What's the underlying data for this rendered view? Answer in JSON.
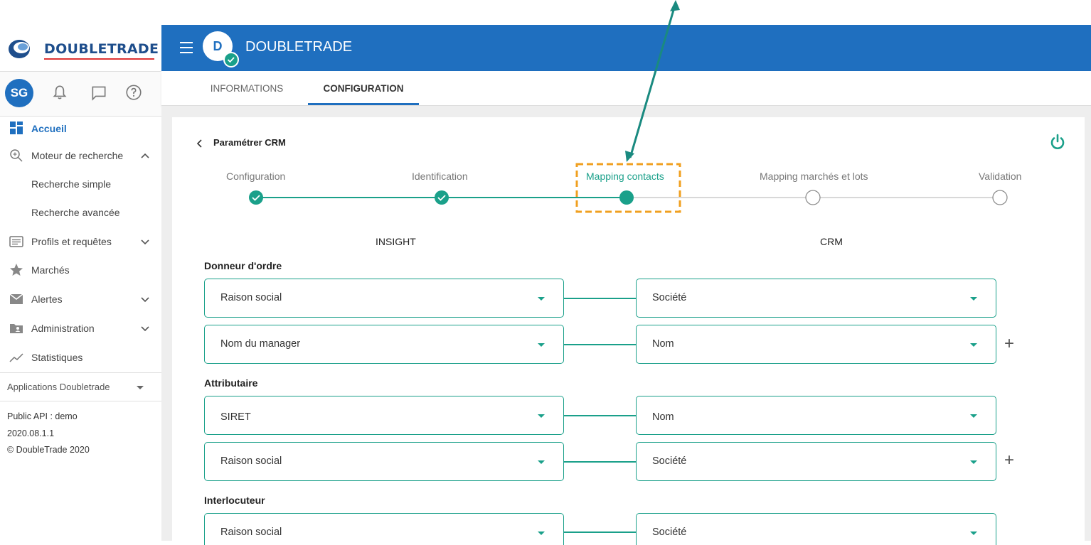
{
  "brand": {
    "logo_text": "DOUBLETRADE",
    "header_title": "DOUBLETRADE",
    "header_avatar": "D",
    "accent": "#1f6fbf",
    "teal": "#1aa08a"
  },
  "user": {
    "initials": "SG"
  },
  "sidebar": {
    "items": [
      {
        "label": "Accueil",
        "icon": "dashboard-icon"
      },
      {
        "label": "Moteur de recherche",
        "icon": "search-icon"
      },
      {
        "label": "Recherche simple"
      },
      {
        "label": "Recherche avancée"
      },
      {
        "label": "Profils et requêtes",
        "icon": "list-icon"
      },
      {
        "label": "Marchés",
        "icon": "star-icon"
      },
      {
        "label": "Alertes",
        "icon": "mail-icon"
      },
      {
        "label": "Administration",
        "icon": "admin-icon"
      },
      {
        "label": "Statistiques",
        "icon": "chart-icon"
      }
    ],
    "apps_label": "Applications Doubletrade",
    "footer": [
      "Public API : demo",
      "2020.08.1.1",
      "© DoubleTrade 2020"
    ]
  },
  "tabs": [
    {
      "label": "INFORMATIONS"
    },
    {
      "label": "CONFIGURATION"
    }
  ],
  "page": {
    "title": "Paramétrer CRM"
  },
  "stepper": {
    "steps": [
      {
        "label": "Configuration",
        "state": "done"
      },
      {
        "label": "Identification",
        "state": "done"
      },
      {
        "label": "Mapping contacts",
        "state": "current"
      },
      {
        "label": "Mapping marchés et lots",
        "state": "todo"
      },
      {
        "label": "Validation",
        "state": "todo"
      }
    ]
  },
  "columns": {
    "left": "INSIGHT",
    "right": "CRM"
  },
  "sections": [
    {
      "title": "Donneur d'ordre",
      "rows": [
        {
          "insight": "Raison social",
          "crm": "Société"
        },
        {
          "insight": "Nom du manager",
          "crm": "Nom"
        }
      ]
    },
    {
      "title": "Attributaire",
      "rows": [
        {
          "insight": "SIRET",
          "crm": "Nom"
        },
        {
          "insight": "Raison social",
          "crm": "Société"
        }
      ]
    },
    {
      "title": "Interlocuteur",
      "rows": [
        {
          "insight": "Raison social",
          "crm": "Société"
        }
      ]
    }
  ],
  "add_symbol": "+"
}
